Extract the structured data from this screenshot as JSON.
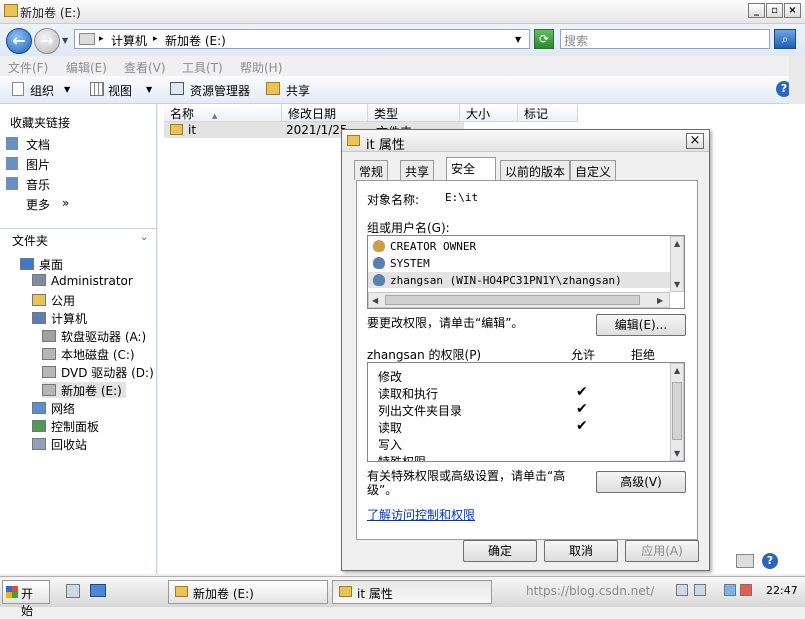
{
  "window": {
    "title": "新加卷 (E:)"
  },
  "address": {
    "crumbs": [
      "计算机",
      "新加卷 (E:)"
    ],
    "search_placeholder": "搜索"
  },
  "menu": [
    "文件(F)",
    "编辑(E)",
    "查看(V)",
    "工具(T)",
    "帮助(H)"
  ],
  "toolbar": {
    "organize": "组织",
    "views": "视图",
    "resource_manager": "资源管理器",
    "share": "共享"
  },
  "nav": {
    "favorites_header": "收藏夹链接",
    "favorites": [
      "文档",
      "图片",
      "音乐"
    ],
    "more": "更多",
    "more_arrow": "»",
    "folders_header": "文件夹",
    "tree": [
      {
        "label": "桌面",
        "depth": 0
      },
      {
        "label": "Administrator",
        "depth": 1
      },
      {
        "label": "公用",
        "depth": 1
      },
      {
        "label": "计算机",
        "depth": 1
      },
      {
        "label": "软盘驱动器 (A:)",
        "depth": 2
      },
      {
        "label": "本地磁盘 (C:)",
        "depth": 2
      },
      {
        "label": "DVD 驱动器 (D:)",
        "depth": 2
      },
      {
        "label": "新加卷 (E:)",
        "depth": 2
      },
      {
        "label": "网络",
        "depth": 1
      },
      {
        "label": "控制面板",
        "depth": 1
      },
      {
        "label": "回收站",
        "depth": 1
      }
    ]
  },
  "columns": [
    "名称",
    "修改日期",
    "类型",
    "大小",
    "标记"
  ],
  "files": [
    {
      "name": "it",
      "date": "2021/1/25",
      "type": "文件夹"
    }
  ],
  "dialog": {
    "title": "it 属性",
    "tabs": [
      "常规",
      "共享",
      "安全",
      "以前的版本",
      "自定义"
    ],
    "active_tab": "安全",
    "object_label": "对象名称:",
    "object_value": "E:\\it",
    "group_label": "组或用户名(G):",
    "users": [
      "CREATOR OWNER",
      "SYSTEM",
      "zhangsan (WIN-HO4PC31PN1Y\\zhangsan)"
    ],
    "selected_user": "zhangsan (WIN-HO4PC31PN1Y\\zhangsan)",
    "edit_prompt": "要更改权限，请单击“编辑”。",
    "edit_button": "编辑(E)...",
    "perm_label": "zhangsan 的权限(P)",
    "allow_label": "允许",
    "deny_label": "拒绝",
    "permissions": [
      {
        "name": "修改",
        "allow": false
      },
      {
        "name": "读取和执行",
        "allow": true
      },
      {
        "name": "列出文件夹目录",
        "allow": true
      },
      {
        "name": "读取",
        "allow": true
      },
      {
        "name": "写入",
        "allow": false
      },
      {
        "name": "特殊权限",
        "allow": false
      }
    ],
    "check_glyph": "✔",
    "advanced_prompt": "有关特殊权限或高级设置，请单击“高级”。",
    "advanced_button": "高级(V)",
    "link": "了解访问控制和权限",
    "ok": "确定",
    "cancel": "取消",
    "apply": "应用(A)"
  },
  "taskbar": {
    "start": "开始",
    "tasks": [
      "新加卷 (E:)",
      "it 属性"
    ],
    "watermark": "https://blog.csdn.net/",
    "clock": "22:47"
  },
  "colors": {
    "accent": "#1f5fb0",
    "link": "#0033cc",
    "selection": "#e3e3e3"
  }
}
